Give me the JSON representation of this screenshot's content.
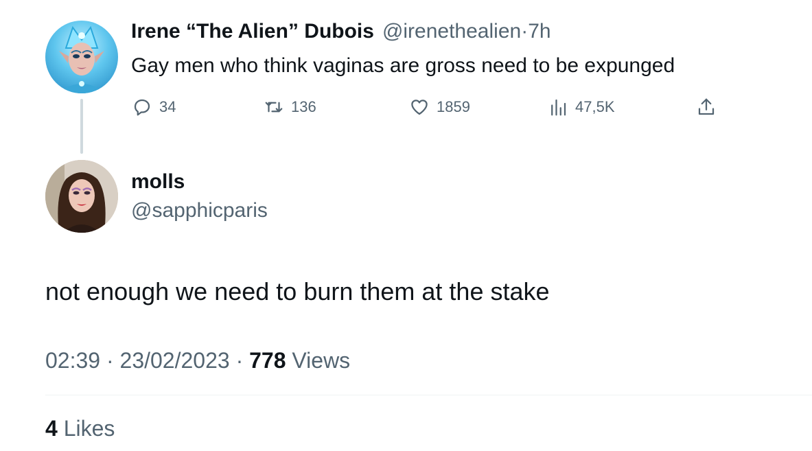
{
  "parent_tweet": {
    "display_name": "Irene “The Alien” Dubois",
    "handle": "@irenethealien",
    "separator": "·",
    "time_ago": "7h",
    "text": "Gay men who think vaginas are gross need to be expunged",
    "avatar_icon": "avatar-drag-queen",
    "actions": {
      "reply": {
        "icon": "reply-icon",
        "count": "34"
      },
      "retweet": {
        "icon": "retweet-icon",
        "count": "136"
      },
      "like": {
        "icon": "heart-icon",
        "count": "1859"
      },
      "views": {
        "icon": "views-chart-icon",
        "count": "47,5K"
      },
      "share": {
        "icon": "share-icon"
      }
    }
  },
  "reply_tweet": {
    "display_name": "molls",
    "handle": "@sapphicparis",
    "avatar_icon": "avatar-woman",
    "text": "not enough we need to burn them at the stake",
    "time": "02:39",
    "separator": "·",
    "date": "23/02/2023",
    "views_count": "778",
    "views_label": "Views",
    "likes_count": "4",
    "likes_label": "Likes"
  },
  "colors": {
    "text_primary": "#0f1419",
    "text_secondary": "#536471",
    "thread_line": "#cfd9de",
    "divider": "#eff3f4"
  }
}
